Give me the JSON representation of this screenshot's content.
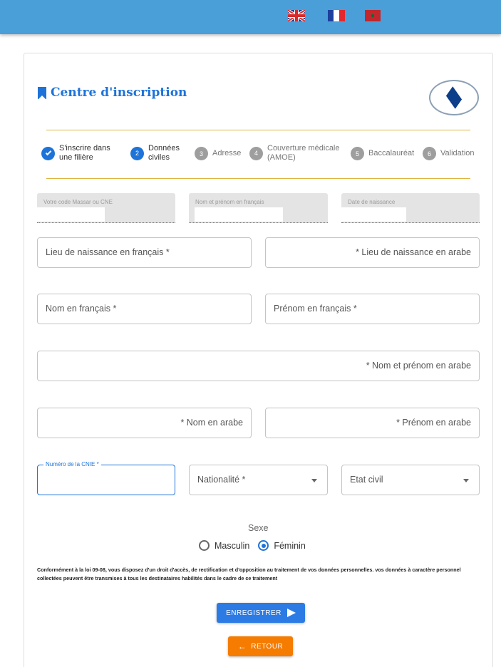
{
  "header": {
    "flags": [
      {
        "name": "English",
        "icon": "uk-flag"
      },
      {
        "name": "Français",
        "icon": "france-flag"
      },
      {
        "name": "العربية",
        "icon": "morocco-flag"
      }
    ]
  },
  "page": {
    "title": "Centre d'inscription",
    "title_icon": "bookmark-icon",
    "logo_icon": "university-logo"
  },
  "stepper": {
    "steps": [
      {
        "number": "1",
        "label_line1": "S'inscrire dans",
        "label_line2": "une filière",
        "state": "done"
      },
      {
        "number": "2",
        "label_line1": "Données",
        "label_line2": "civiles",
        "state": "active"
      },
      {
        "number": "3",
        "label_line1": "Adresse",
        "label_line2": "",
        "state": "inactive"
      },
      {
        "number": "4",
        "label_line1": "Couverture médicale",
        "label_line2": "(AMOE)",
        "state": "inactive"
      },
      {
        "number": "5",
        "label_line1": "Baccalauréat",
        "label_line2": "",
        "state": "inactive"
      },
      {
        "number": "6",
        "label_line1": "Validation",
        "label_line2": "",
        "state": "inactive"
      }
    ]
  },
  "form": {
    "massar_label": "Votre code Massar ou CNE",
    "nom_prenom_fr_label": "Nom et prénom en français",
    "date_naissance_label": "Date de naissance",
    "lieu_naissance_fr": "Lieu de naissance en français *",
    "lieu_naissance_ar": "* Lieu de naissance en arabe",
    "nom_fr": "Nom en français *",
    "prenom_fr": "Prénom en français  *",
    "nom_prenom_ar": "* Nom et prénom en arabe",
    "nom_ar": "* Nom en arabe",
    "prenom_ar": "* Prénom en arabe",
    "cnie_label": "Numéro de la CNIE *",
    "nationalite": "Nationalité *",
    "etat_civil": "Etat civil",
    "sexe_label": "Sexe",
    "sexe_options": [
      "Masculin",
      "Féminin"
    ],
    "sexe_selected": "Féminin"
  },
  "legal_text": "Conformément à la loi 09-08, vous disposez d'un droit d'accès, de rectification et d'opposition au traitement de vos données personnelles. vos données à caractère personnel collectées peuvent être transmises à tous les destinataires habilités dans le cadre de ce traitement",
  "buttons": {
    "save": "ENREGISTRER",
    "back": "RETOUR"
  },
  "colors": {
    "topbar": "#4a9fd8",
    "primary": "#1e73d9",
    "accent_rule": "#e0b440",
    "back_button": "#f57c00"
  }
}
